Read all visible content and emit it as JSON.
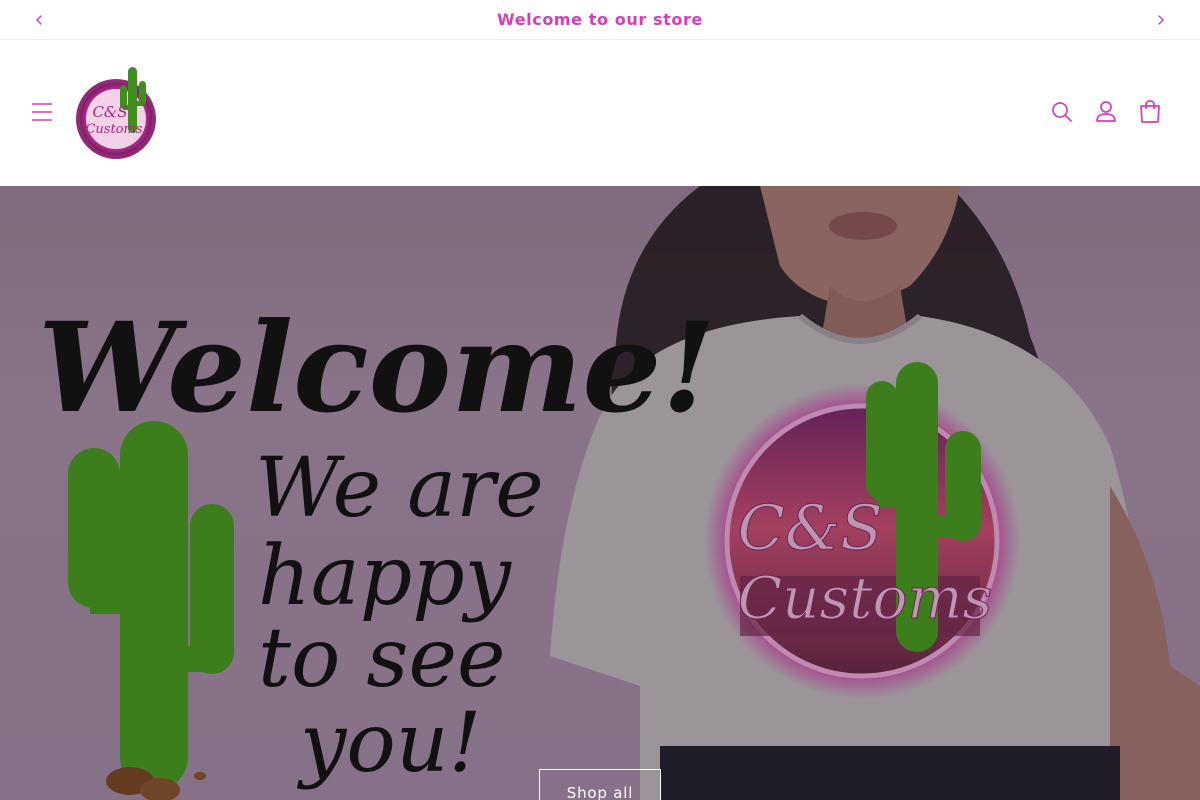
{
  "announcement": {
    "message": "Welcome to our store",
    "prev_icon": "chevron-left-icon",
    "next_icon": "chevron-right-icon"
  },
  "header": {
    "menu_icon": "hamburger-menu-icon",
    "logo_text_line1": "C&S",
    "logo_text_line2": "Customs",
    "search_icon": "search-icon",
    "account_icon": "user-icon",
    "cart_icon": "shopping-bag-icon"
  },
  "hero": {
    "headline": "Welcome!",
    "subline_1": "We are",
    "subline_2": "happy",
    "subline_3": "to see",
    "subline_4": "you!",
    "shirt_logo_line1": "C&S",
    "shirt_logo_line2": "Customs",
    "cta_label": "Shop all"
  },
  "colors": {
    "accent": "#d63db8",
    "hero_overlay": "#a48aa6",
    "cactus": "#3f8f1f"
  }
}
